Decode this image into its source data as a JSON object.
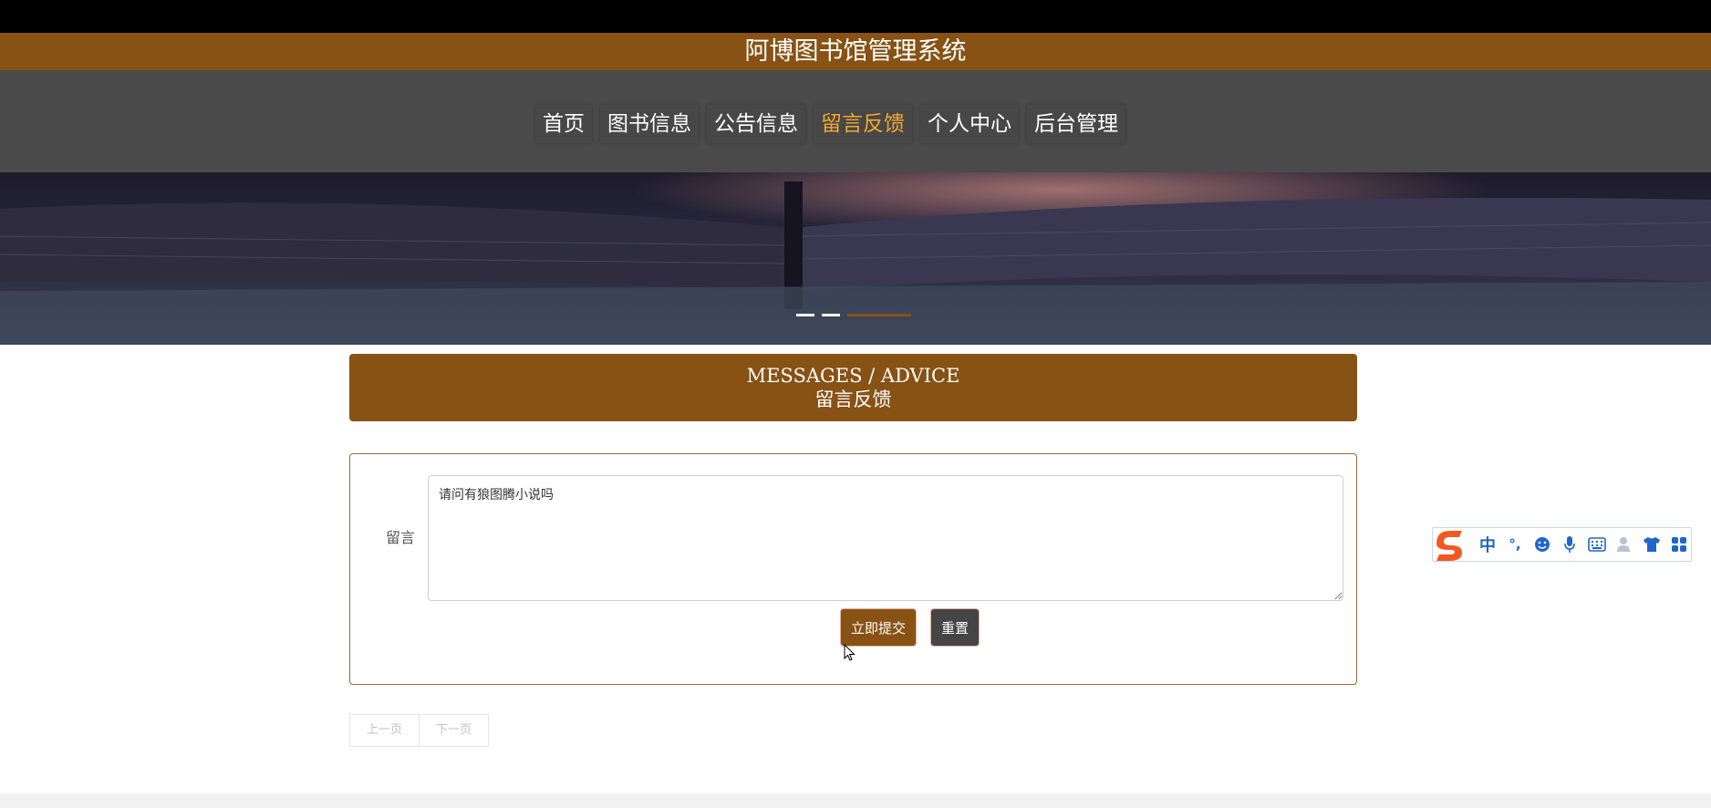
{
  "app": {
    "title": "阿博图书馆管理系统"
  },
  "nav": {
    "items": [
      {
        "label": "首页"
      },
      {
        "label": "图书信息"
      },
      {
        "label": "公告信息"
      },
      {
        "label": "留言反馈",
        "active": true
      },
      {
        "label": "个人中心"
      },
      {
        "label": "后台管理"
      }
    ]
  },
  "banner": {
    "slide_count": 3,
    "active_slide": 3
  },
  "section": {
    "title_en": "MESSAGES / ADVICE",
    "title_cn": "留言反馈"
  },
  "form": {
    "message_label": "留言",
    "message_value": "请问有狼图腾小说吗",
    "submit_label": "立即提交",
    "reset_label": "重置"
  },
  "pagination": {
    "prev_label": "上一页",
    "next_label": "下一页"
  },
  "ime_toolbar": {
    "mode_label": "中",
    "punct_label": "°,",
    "icons": [
      "smiley-icon",
      "microphone-icon",
      "keyboard-icon",
      "user-icon",
      "shirt-icon",
      "grid-icon"
    ]
  },
  "colors": {
    "brand": "#875214",
    "nav_bg": "#4a4a4a",
    "nav_active": "#f1a92c"
  }
}
